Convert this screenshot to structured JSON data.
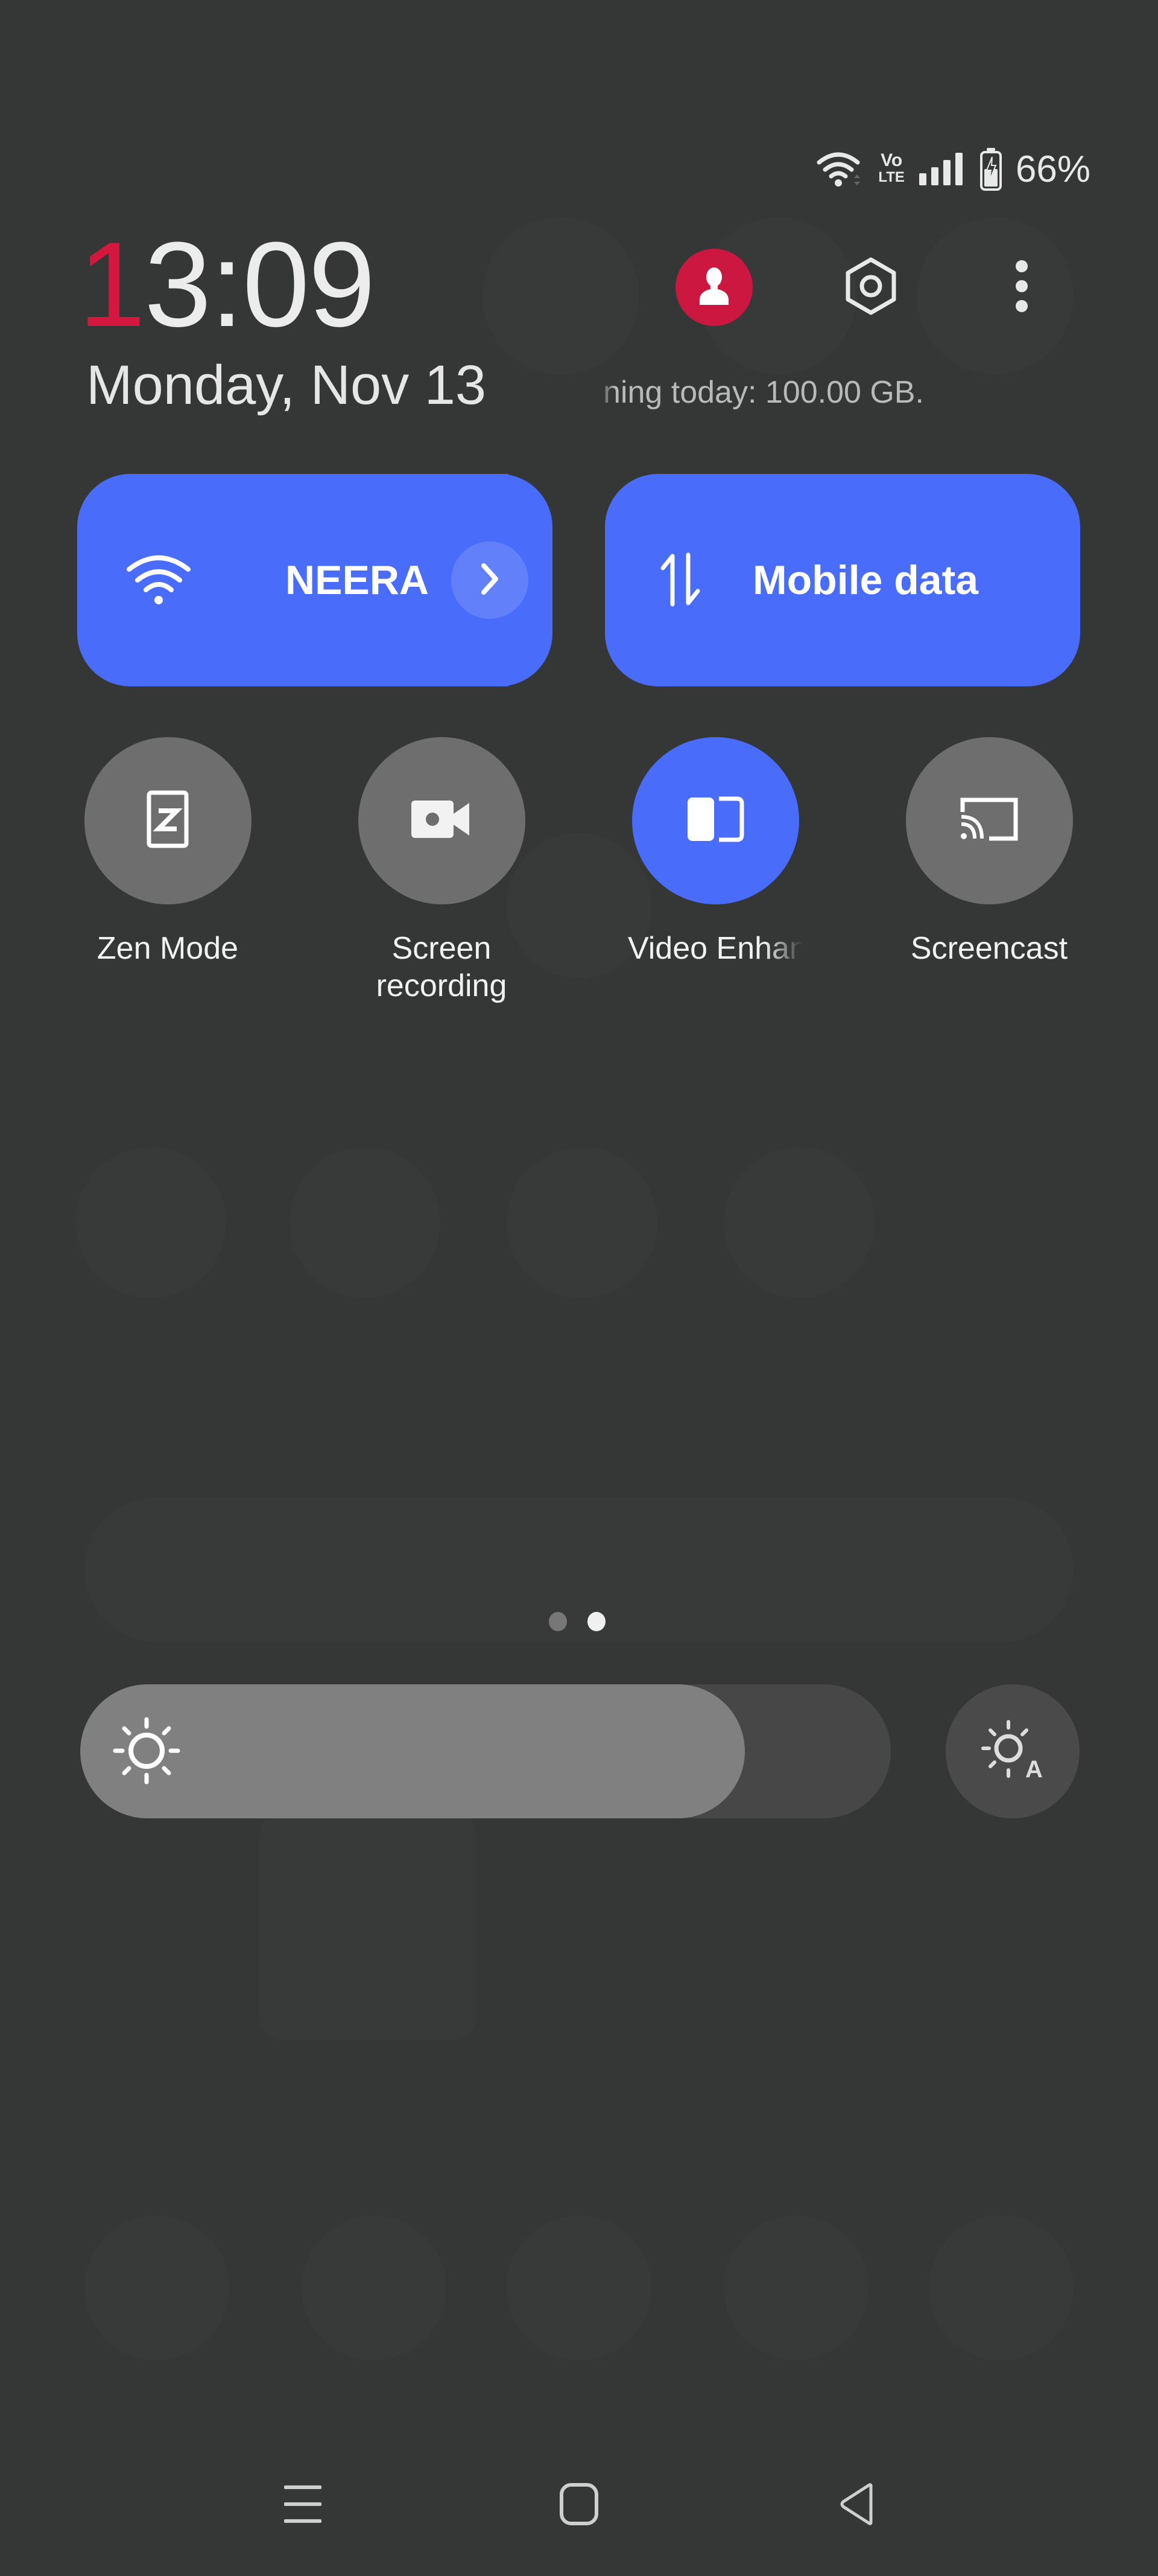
{
  "status_bar": {
    "icons": [
      "wifi-icon",
      "volte-icon",
      "signal-icon",
      "battery-charging-icon"
    ],
    "volte_top": "Vo",
    "volte_bottom": "LTE",
    "battery_percent": "66%"
  },
  "header": {
    "clock_first_digit": "1",
    "clock_rest": "3:09",
    "date": "Monday, Nov 13",
    "data_note": "ning today: 100.00 GB.",
    "icons": {
      "user": "user-icon",
      "settings": "settings-icon",
      "more": "more-vertical-icon"
    }
  },
  "big_tiles": {
    "wifi": {
      "label": "NEERA",
      "icon": "wifi-icon",
      "detail_icon": "chevron-right-icon",
      "active": true
    },
    "mobile_data": {
      "label": "Mobile data",
      "icon": "data-arrows-icon",
      "active": true
    }
  },
  "toggles": [
    {
      "label": "Zen Mode",
      "icon": "zen-mode-icon",
      "active": false
    },
    {
      "label": "Screen\nrecording",
      "icon": "video-camera-icon",
      "active": false
    },
    {
      "label": "Video Enhan",
      "icon": "video-enhance-icon",
      "active": true
    },
    {
      "label": "Screencast",
      "icon": "cast-icon",
      "active": false
    }
  ],
  "pager": {
    "pages": 2,
    "current": 2
  },
  "brightness": {
    "level": 0.82,
    "icon": "brightness-icon",
    "auto_icon": "auto-brightness-icon"
  },
  "nav": {
    "recents": "menu-icon",
    "home": "home-icon",
    "back": "back-icon"
  },
  "colors": {
    "accent": "#4a6cfb",
    "user_badge": "#cc1840",
    "clock_highlight": "#d3173f",
    "background": "#353636"
  }
}
